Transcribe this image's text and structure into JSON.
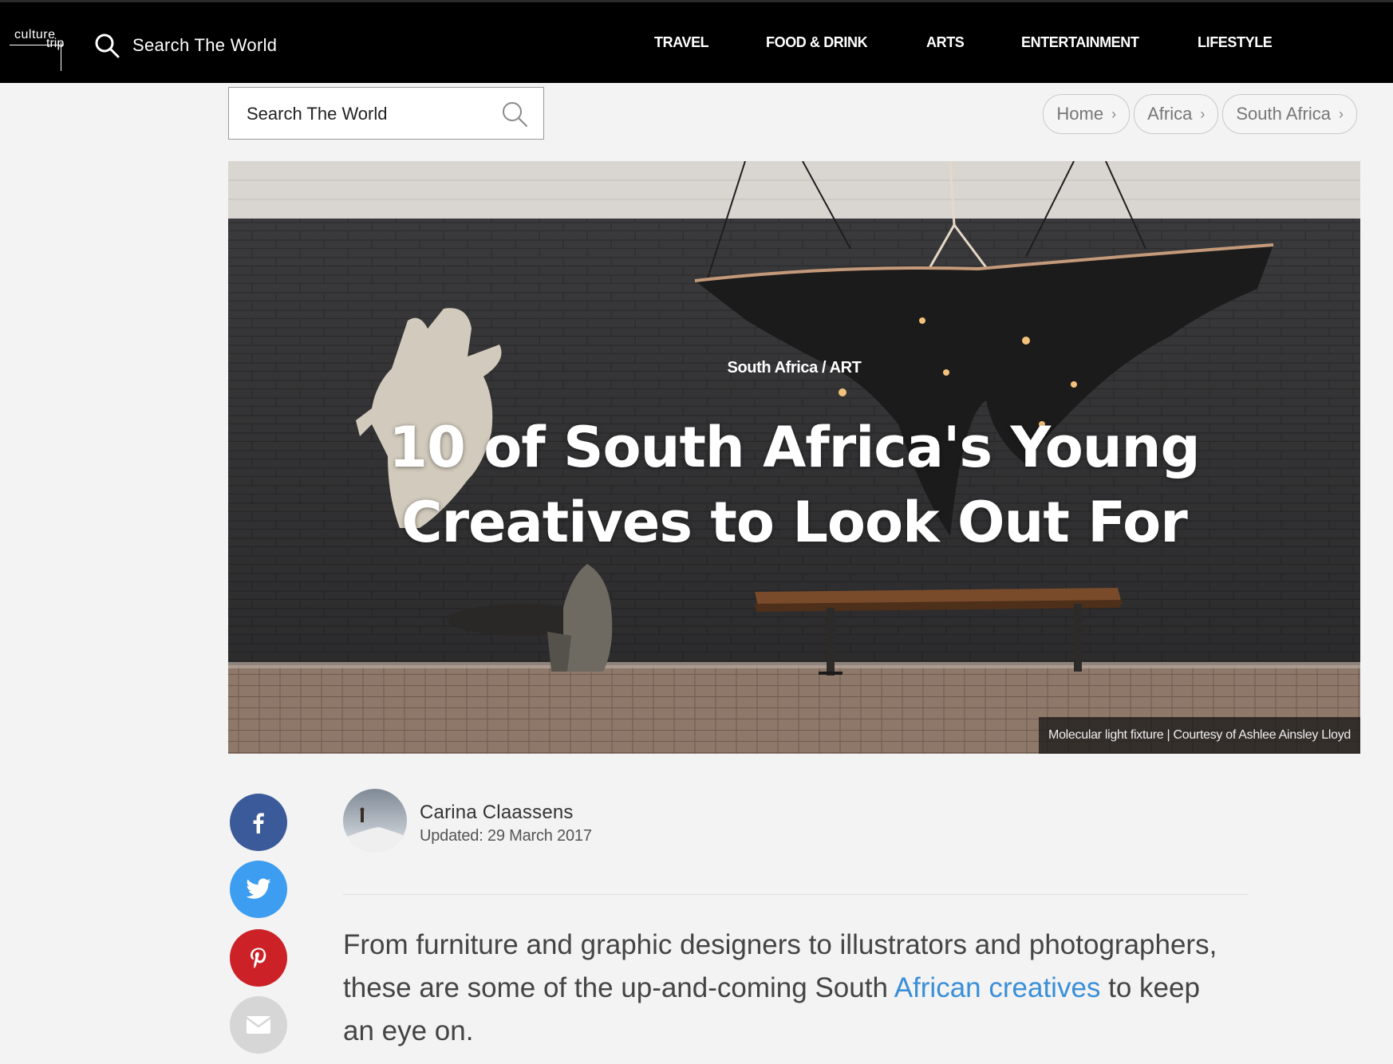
{
  "header": {
    "logo_line1": "culture",
    "logo_line2": "trip",
    "search_label": "Search The World",
    "nav": [
      "TRAVEL",
      "FOOD & DRINK",
      "ARTS",
      "ENTERTAINMENT",
      "LIFESTYLE"
    ]
  },
  "search": {
    "placeholder": "Search The World"
  },
  "breadcrumbs": [
    "Home",
    "Africa",
    "South Africa"
  ],
  "hero": {
    "kicker": "South Africa / ART",
    "title_line1": "10 of South Africa's Young",
    "title_line2": "Creatives to Look Out For",
    "caption": "Molecular light fixture | Courtesy of Ashlee Ainsley Lloyd"
  },
  "share": {
    "facebook_icon": "facebook-icon",
    "twitter_icon": "twitter-icon",
    "pinterest_icon": "pinterest-icon",
    "email_icon": "email-icon",
    "colors": {
      "facebook": "#3b5a9a",
      "twitter": "#3d9df0",
      "pinterest": "#cc2127",
      "email": "#d6d6d6"
    }
  },
  "author": {
    "name": "Carina Claassens",
    "updated": "Updated: 29 March 2017"
  },
  "intro": {
    "text_before": "From furniture and graphic designers to illustrators and photographers, these are some of the up-and-coming South ",
    "link": "African creatives",
    "text_after": " to keep an eye on."
  },
  "colors": {
    "link": "#3a8fd8",
    "topbar": "#000000",
    "page_bg": "#f3f3f3"
  }
}
